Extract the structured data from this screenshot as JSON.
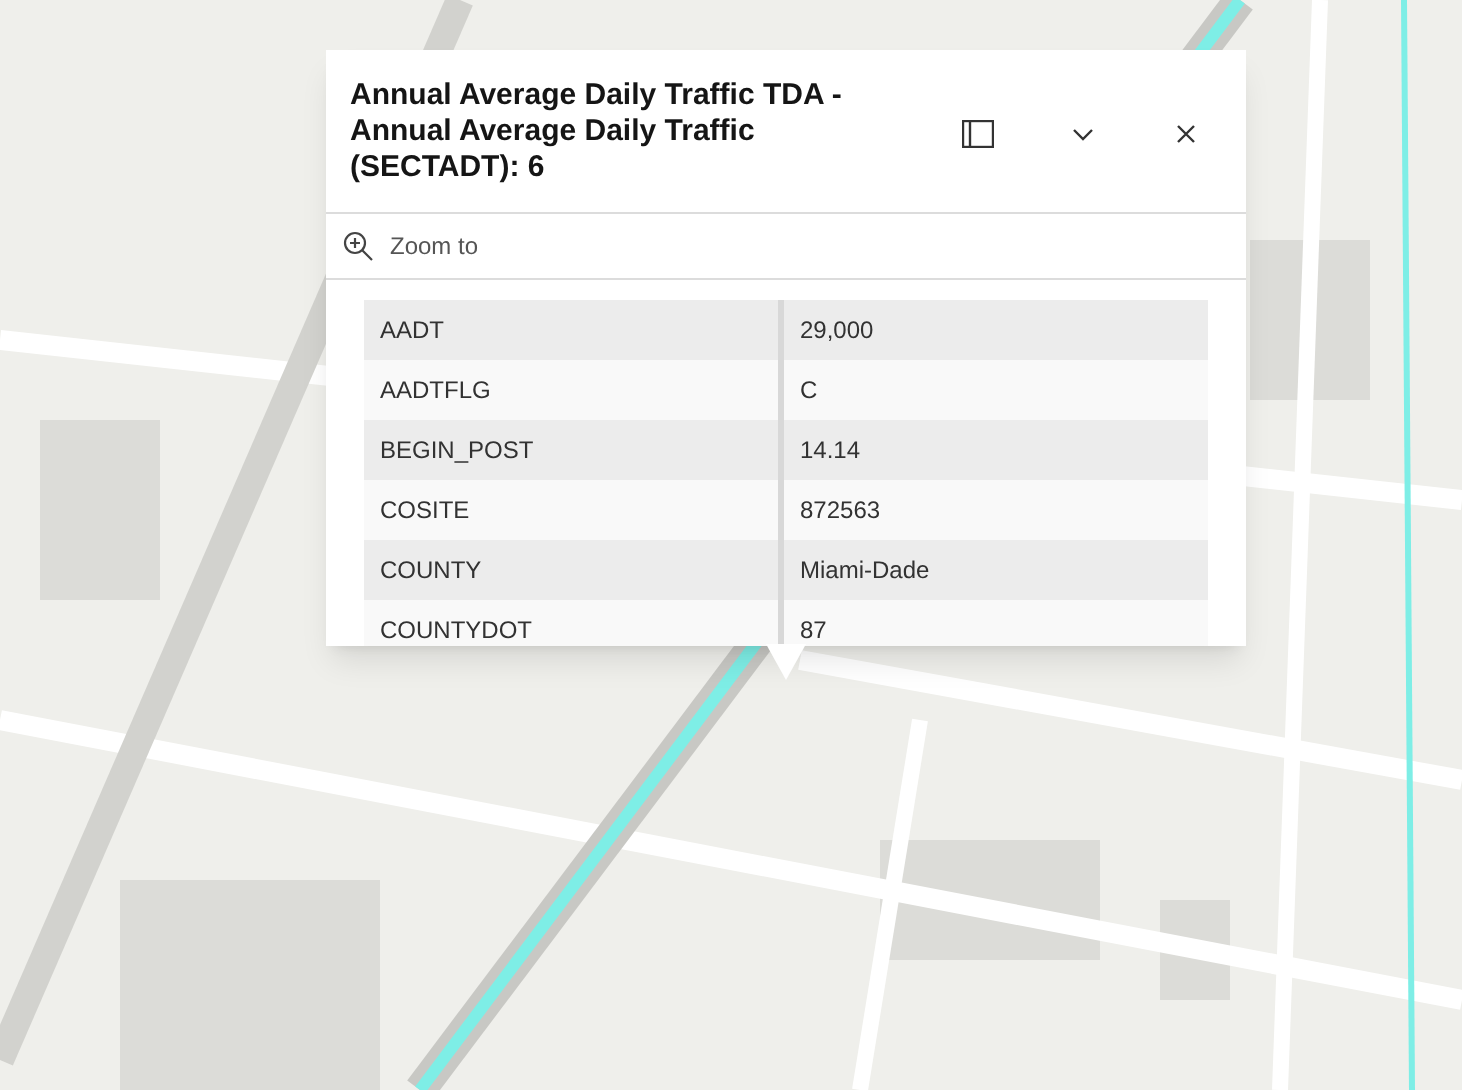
{
  "popup": {
    "title": "Annual Average Daily Traffic TDA - Annual Average Daily Traffic (SECTADT): 6",
    "actions": [
      {
        "label": "Zoom to"
      }
    ],
    "fields": [
      {
        "name": "AADT",
        "value": "29,000"
      },
      {
        "name": "AADTFLG",
        "value": "C"
      },
      {
        "name": "BEGIN_POST",
        "value": "14.14"
      },
      {
        "name": "COSITE",
        "value": "872563"
      },
      {
        "name": "COUNTY",
        "value": "Miami-Dade"
      },
      {
        "name": "COUNTYDOT",
        "value": "87"
      }
    ]
  }
}
